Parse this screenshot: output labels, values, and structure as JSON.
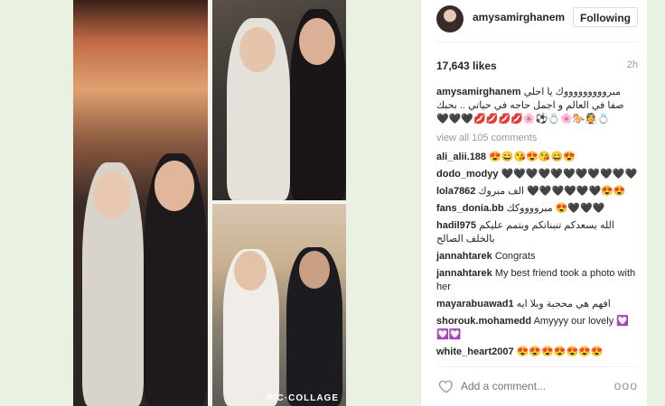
{
  "collage": {
    "watermark": "PIC·COLLAGE"
  },
  "post": {
    "username": "amysamirghanem",
    "follow_label": "Following",
    "likes": "17,643 likes",
    "time": "2h",
    "caption": {
      "user": "amysamirghanem",
      "text": "مبروووووووووك يا احلي صفا في العالم و اجمل حاجه في حياتي .. بحبك 💍👰🐎🌸💍⚽🌸💋💋💋💋🖤🖤🖤"
    },
    "view_all": "view all 105 comments",
    "comments": [
      {
        "user": "ali_alii.188",
        "text": "😍😄😘😍😘😄😍"
      },
      {
        "user": "dodo_modyy",
        "text": "🖤🖤🖤🖤🖤🖤🖤🖤🖤🖤🖤"
      },
      {
        "user": "lola7862",
        "text": "الف مبروك 🖤🖤🖤🖤🖤🖤😍😍"
      },
      {
        "user": "fans_donia.bb",
        "text": "مبرووووكك 😍🖤🖤🖤"
      },
      {
        "user": "hadil975",
        "text": "الله يسعدكم تنبناتكم ويتمم عليكم بالخلف الصالح"
      },
      {
        "user": "jannahtarek",
        "text": "Congrats"
      },
      {
        "user": "jannahtarek",
        "text": "My best friend took a photo with her"
      },
      {
        "user": "mayarabuawad1",
        "text": "افهم هي محجبة وبلا ايه"
      },
      {
        "user": "shorouk.mohamedd",
        "text": "Amyyyy our lovely 💟💟💟"
      },
      {
        "user": "white_heart2007",
        "text": "😍😍😍😍😍😍😍"
      }
    ],
    "add_comment_placeholder": "Add a comment...",
    "more_label": "ooo"
  }
}
